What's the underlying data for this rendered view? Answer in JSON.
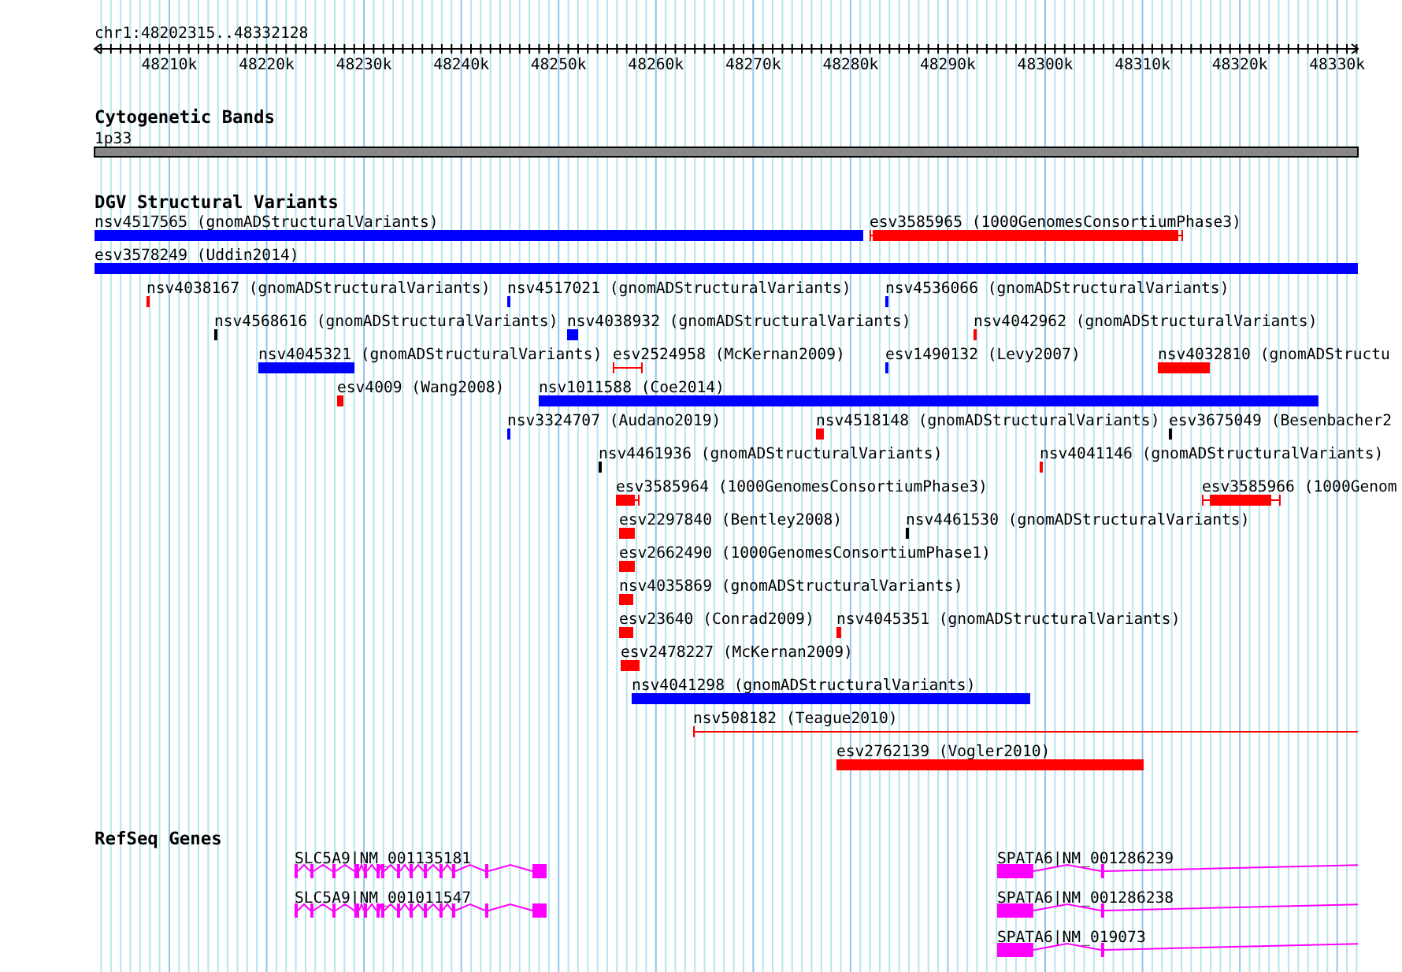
{
  "location": "chr1:48202315..48332128",
  "ruler": {
    "tick_labels": [
      "48210k",
      "48220k",
      "48230k",
      "48240k",
      "48250k",
      "48260k",
      "48270k",
      "48280k",
      "48290k",
      "48300k",
      "48310k",
      "48320k",
      "48330k"
    ]
  },
  "cytoband_track": {
    "title": "Cytogenetic Bands",
    "band": "1p33"
  },
  "variant_track": {
    "title": "DGV Structural Variants",
    "features": [
      {
        "label": "nsv4517565 (gnomADStructuralVariants)",
        "kind": "bar",
        "color": "#0000ff"
      },
      {
        "label": "esv3585965 (1000GenomesConsortiumPhase3)",
        "kind": "capped",
        "color": "#ff0000"
      },
      {
        "label": "esv3578249 (Uddin2014)",
        "kind": "bar",
        "color": "#0000ff"
      },
      {
        "label": "nsv4038167 (gnomADStructuralVariants)",
        "kind": "bar",
        "color": "#ff0000"
      },
      {
        "label": "nsv4517021 (gnomADStructuralVariants)",
        "kind": "bar",
        "color": "#0000ff"
      },
      {
        "label": "nsv4536066 (gnomADStructuralVariants)",
        "kind": "bar",
        "color": "#0000ff"
      },
      {
        "label": "nsv4568616 (gnomADStructuralVariants)",
        "kind": "bar",
        "color": "#000000"
      },
      {
        "label": "nsv4038932 (gnomADStructuralVariants)",
        "kind": "bar",
        "color": "#0000ff"
      },
      {
        "label": "nsv4042962 (gnomADStructuralVariants)",
        "kind": "bar",
        "color": "#ff0000"
      },
      {
        "label": "nsv4045321 (gnomADStructuralVariants)",
        "kind": "bar",
        "color": "#0000ff"
      },
      {
        "label": "esv2524958 (McKernan2009)",
        "kind": "interval",
        "color": "#ff0000"
      },
      {
        "label": "esv1490132 (Levy2007)",
        "kind": "bar",
        "color": "#0000ff"
      },
      {
        "label": "nsv4032810 (gnomADStructu",
        "kind": "bar",
        "color": "#ff0000"
      },
      {
        "label": "esv4009 (Wang2008)",
        "kind": "bar",
        "color": "#ff0000"
      },
      {
        "label": "nsv1011588 (Coe2014)",
        "kind": "bar",
        "color": "#0000ff"
      },
      {
        "label": "nsv3324707 (Audano2019)",
        "kind": "bar",
        "color": "#0000ff"
      },
      {
        "label": "nsv4518148 (gnomADStructuralVariants)",
        "kind": "bar",
        "color": "#ff0000"
      },
      {
        "label": "esv3675049 (Besenbacher2",
        "kind": "bar",
        "color": "#000000"
      },
      {
        "label": "nsv4461936 (gnomADStructuralVariants)",
        "kind": "bar",
        "color": "#000000"
      },
      {
        "label": "nsv4041146 (gnomADStructuralVariants)",
        "kind": "bar",
        "color": "#ff0000"
      },
      {
        "label": "esv3585964 (1000GenomesConsortiumPhase3)",
        "kind": "capped",
        "color": "#ff0000"
      },
      {
        "label": "esv3585966 (1000Genom",
        "kind": "capped",
        "color": "#ff0000"
      },
      {
        "label": "esv2297840 (Bentley2008)",
        "kind": "bar",
        "color": "#ff0000"
      },
      {
        "label": "nsv4461530 (gnomADStructuralVariants)",
        "kind": "bar",
        "color": "#000000"
      },
      {
        "label": "esv2662490 (1000GenomesConsortiumPhase1)",
        "kind": "bar",
        "color": "#ff0000"
      },
      {
        "label": "nsv4035869 (gnomADStructuralVariants)",
        "kind": "bar",
        "color": "#ff0000"
      },
      {
        "label": "esv23640 (Conrad2009)",
        "kind": "bar",
        "color": "#ff0000"
      },
      {
        "label": "nsv4045351 (gnomADStructuralVariants)",
        "kind": "bar",
        "color": "#ff0000"
      },
      {
        "label": "esv2478227 (McKernan2009)",
        "kind": "bar",
        "color": "#ff0000"
      },
      {
        "label": "nsv4041298 (gnomADStructuralVariants)",
        "kind": "bar",
        "color": "#0000ff"
      },
      {
        "label": "nsv508182 (Teague2010)",
        "kind": "interval",
        "color": "#ff0000"
      },
      {
        "label": "esv2762139 (Vogler2010)",
        "kind": "bar",
        "color": "#ff0000"
      }
    ]
  },
  "gene_track": {
    "title": "RefSeq Genes",
    "transcripts": [
      {
        "label": "SLC5A9|NM_001135181"
      },
      {
        "label": "SLC5A9|NM_001011547"
      },
      {
        "label": "SPATA6|NM_001286239"
      },
      {
        "label": "SPATA6|NM_001286238"
      },
      {
        "label": "SPATA6|NM_019073"
      }
    ]
  }
}
